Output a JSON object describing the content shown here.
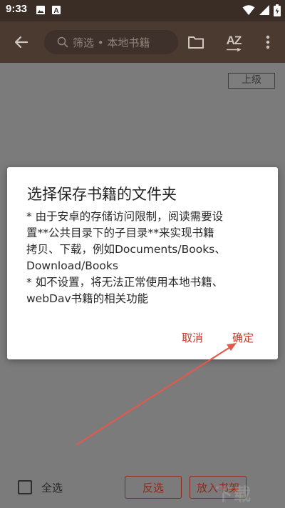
{
  "status_bar": {
    "time": "9:33",
    "icons": [
      "image-icon",
      "a-box-icon",
      "wifi-icon",
      "battery-icon"
    ]
  },
  "toolbar": {
    "back_icon": "arrow-left-icon",
    "search_placeholder": "筛选 • 本地书籍",
    "folder_icon": "folder-icon",
    "sort_label": "AZ",
    "more_icon": "more-vert-icon"
  },
  "content": {
    "parent_button": "上级"
  },
  "bottom_bar": {
    "select_all_label": "全选",
    "invert_button": "反选",
    "add_to_shelf_button": "放入书架"
  },
  "dialog": {
    "title": "选择保存书籍的文件夹",
    "message_lines": [
      "* 由于安卓的存储访问限制，阅读需要设",
      "置**公共目录下的子目录**来实现书籍",
      "拷贝、下载，例如Documents/Books、",
      "Download/Books",
      "* 如不设置，将无法正常使用本地书籍、",
      "webDav书籍的相关功能"
    ],
    "cancel_button": "取消",
    "ok_button": "确定"
  },
  "colors": {
    "toolbar_bg": "#4a3a30",
    "status_bg": "#3a2d26",
    "accent": "#c0392b",
    "dim_bg": "#7b7b7b",
    "arrow": "#e05a4e"
  }
}
